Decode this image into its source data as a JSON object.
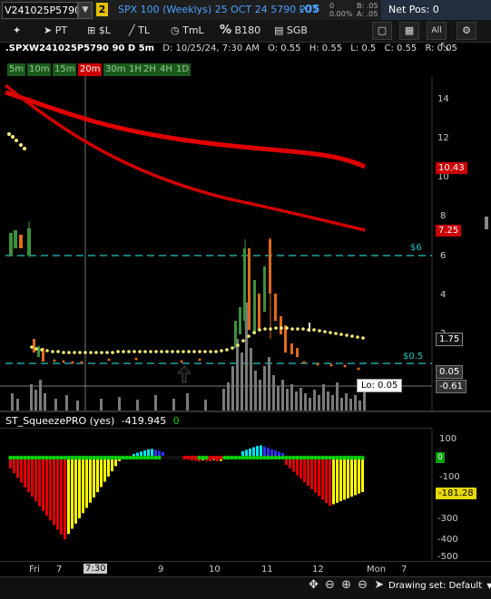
{
  "header": {
    "symbol": "V241025P5790",
    "link_group": "2",
    "description": "SPX 100 (Weeklys) 25 OCT 24 5790 PUT",
    "price": ".05",
    "change": "0",
    "change_pct": "0.00%",
    "bid": "B: .05",
    "ask": "A: .05",
    "net_pos": "Net Pos: 0"
  },
  "toolbar": {
    "pt": "PT",
    "sl": "$L",
    "tl": "TL",
    "tml": "TmL",
    "b180": "B180",
    "sgb": "SGB",
    "all": "All"
  },
  "infobar": {
    "symbol": ".SPXW241025P5790 90 D 5m",
    "date": "D: 10/25/24, 7:30 AM",
    "open": "O: 0.55",
    "high": "H: 0.55",
    "low": "L: 0.5",
    "close": "C: 0.55",
    "range": "R: 0.05"
  },
  "timeframes": [
    {
      "label": "5m",
      "active": false
    },
    {
      "label": "10m",
      "active": false
    },
    {
      "label": "15m",
      "active": false
    },
    {
      "label": "20m",
      "active": true
    },
    {
      "label": "30m",
      "active": false
    },
    {
      "label": "1H",
      "active": false
    },
    {
      "label": "2H",
      "active": false
    },
    {
      "label": "4H",
      "active": false
    },
    {
      "label": "1D",
      "active": false
    }
  ],
  "price_axis": [
    "14",
    "12",
    "10",
    "8",
    "6",
    "4",
    "2"
  ],
  "price_tags": {
    "ma_fast": "10.43",
    "ma_slow": "7.25",
    "ema": "1.75",
    "last": "0.05",
    "crosshair": "-0.61"
  },
  "levels": {
    "upper": "$6",
    "lower": "$0.5"
  },
  "low_tooltip": "Lo: 0.05",
  "indicator": {
    "name": "ST_SqueezePRO (yes)",
    "value": "-419.945",
    "zero_label": "0",
    "axis": [
      "100",
      "0",
      "-100",
      "-200",
      "-300",
      "-400",
      "-500"
    ],
    "current": "-181.28"
  },
  "time_axis": [
    "Fri",
    "7",
    "7:30",
    "9",
    "10",
    "11",
    "12",
    "Mon",
    "7"
  ],
  "bottom": {
    "drawing_set": "Drawing set: Default"
  },
  "colors": {
    "accent_blue": "#4aa0ff",
    "ma_red": "#e00000",
    "ema_yellow": "#f5f07a",
    "level_cyan": "#20c8c8",
    "hist_red": "#e00000",
    "hist_yellow": "#ffff00",
    "hist_cyan": "#00e5ff",
    "hist_blue": "#3030ff",
    "dot_green": "#00d000"
  }
}
